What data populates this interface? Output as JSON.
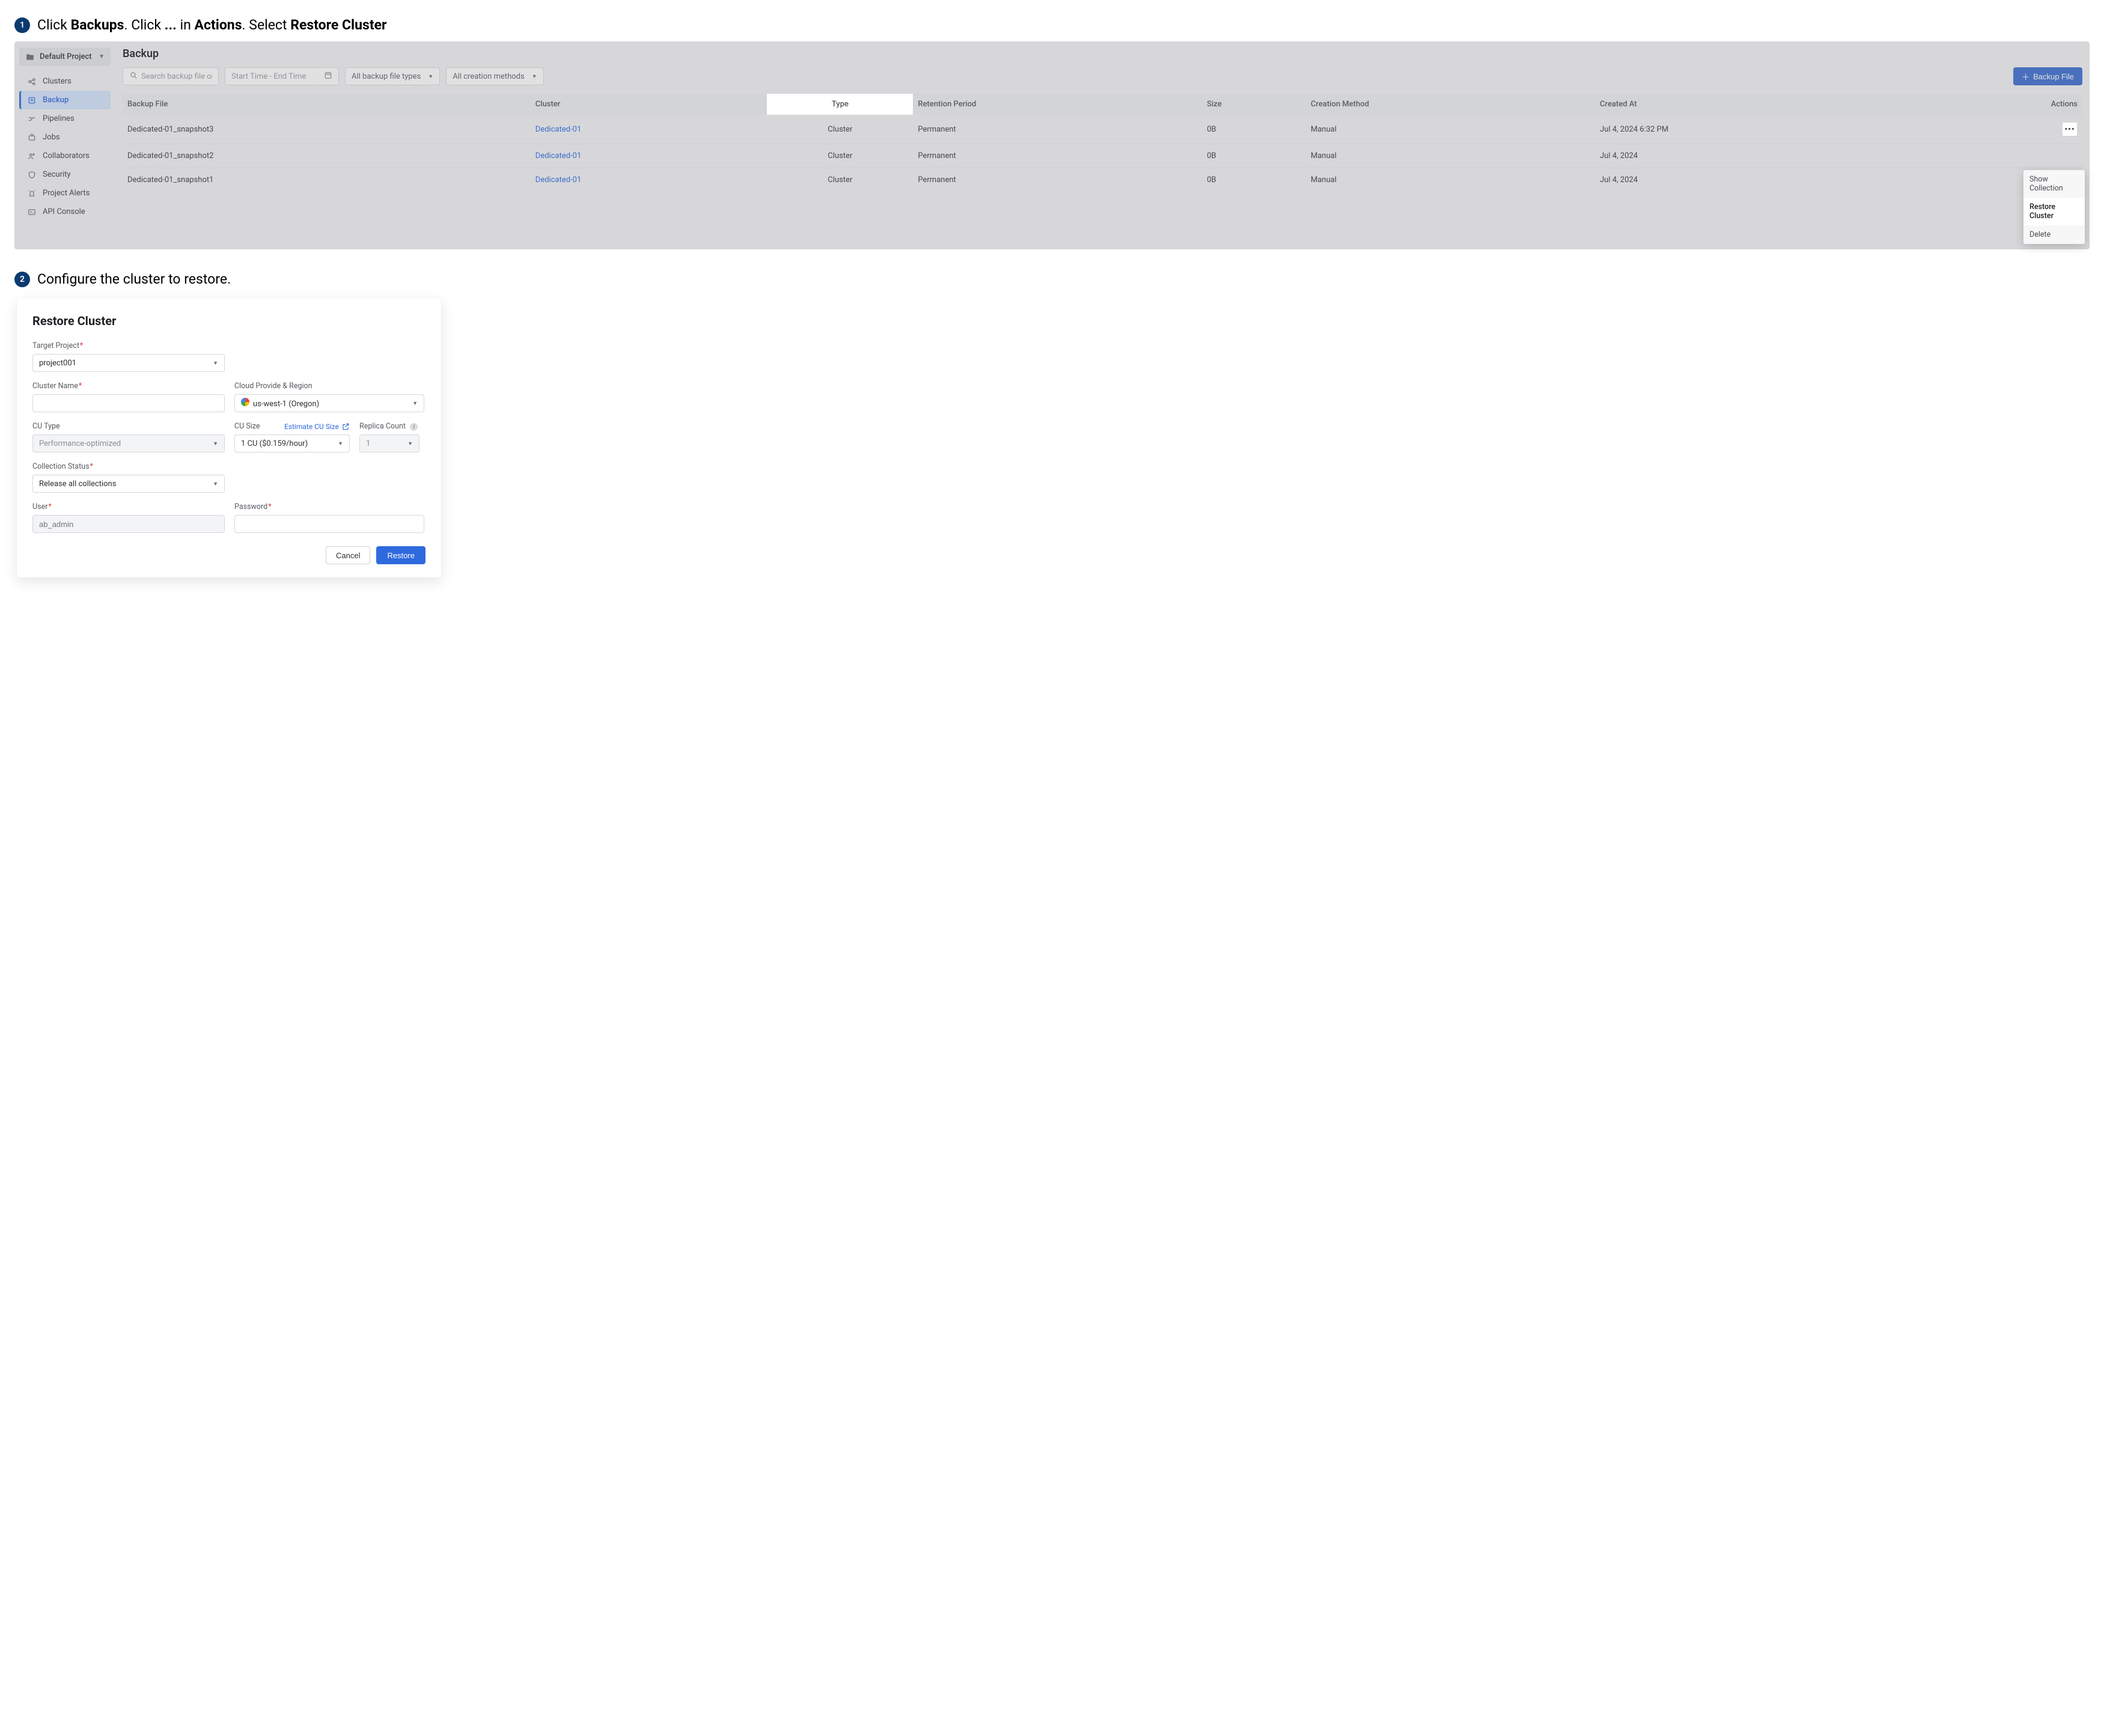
{
  "step1": {
    "number": "1",
    "text_pre": "Click ",
    "b1": "Backups",
    "text_mid1": ". Click ",
    "b2": "...",
    "text_mid2": " in ",
    "b3": "Actions",
    "text_mid3": ". Select ",
    "b4": "Restore Cluster"
  },
  "step2": {
    "number": "2",
    "text": "Configure the cluster to restore."
  },
  "sidebar": {
    "project": "Default Project",
    "items": [
      {
        "label": "Clusters"
      },
      {
        "label": "Backup"
      },
      {
        "label": "Pipelines"
      },
      {
        "label": "Jobs"
      },
      {
        "label": "Collaborators"
      },
      {
        "label": "Security"
      },
      {
        "label": "Project Alerts"
      },
      {
        "label": "API Console"
      }
    ]
  },
  "backup": {
    "title": "Backup",
    "search_placeholder": "Search backup file or cluster",
    "timerange_placeholder": "Start Time - End Time",
    "filter_types": "All backup file types",
    "filter_methods": "All creation methods",
    "add_button": "Backup File",
    "columns": {
      "file": "Backup File",
      "cluster": "Cluster",
      "type": "Type",
      "retention": "Retention Period",
      "size": "Size",
      "method": "Creation Method",
      "created": "Created At",
      "actions": "Actions"
    },
    "rows": [
      {
        "file": "Dedicated-01_snapshot3",
        "cluster": "Dedicated-01",
        "type": "Cluster",
        "retention": "Permanent",
        "size": "0B",
        "method": "Manual",
        "created": "Jul 4, 2024 6:32 PM"
      },
      {
        "file": "Dedicated-01_snapshot2",
        "cluster": "Dedicated-01",
        "type": "Cluster",
        "retention": "Permanent",
        "size": "0B",
        "method": "Manual",
        "created": "Jul 4, 2024"
      },
      {
        "file": "Dedicated-01_snapshot1",
        "cluster": "Dedicated-01",
        "type": "Cluster",
        "retention": "Permanent",
        "size": "0B",
        "method": "Manual",
        "created": "Jul 4, 2024"
      }
    ],
    "menu": {
      "show": "Show Collection",
      "restore": "Restore Cluster",
      "delete": "Delete"
    }
  },
  "restore": {
    "title": "Restore Cluster",
    "labels": {
      "target_project": "Target Project",
      "cluster_name": "Cluster Name",
      "cloud_region": "Cloud Provide & Region",
      "cu_type": "CU Type",
      "cu_size": "CU Size",
      "estimate": "Estimate CU Size",
      "replica": "Replica Count",
      "collection_status": "Collection Status",
      "user": "User",
      "password": "Password"
    },
    "values": {
      "target_project": "project001",
      "region": "us-west-1 (Oregon)",
      "cu_type": "Performance-optimized",
      "cu_size": "1 CU ($0.159/hour)",
      "replica": "1",
      "collection_status": "Release all collections",
      "user_placeholder": "ab_admin"
    },
    "buttons": {
      "cancel": "Cancel",
      "restore": "Restore"
    }
  }
}
